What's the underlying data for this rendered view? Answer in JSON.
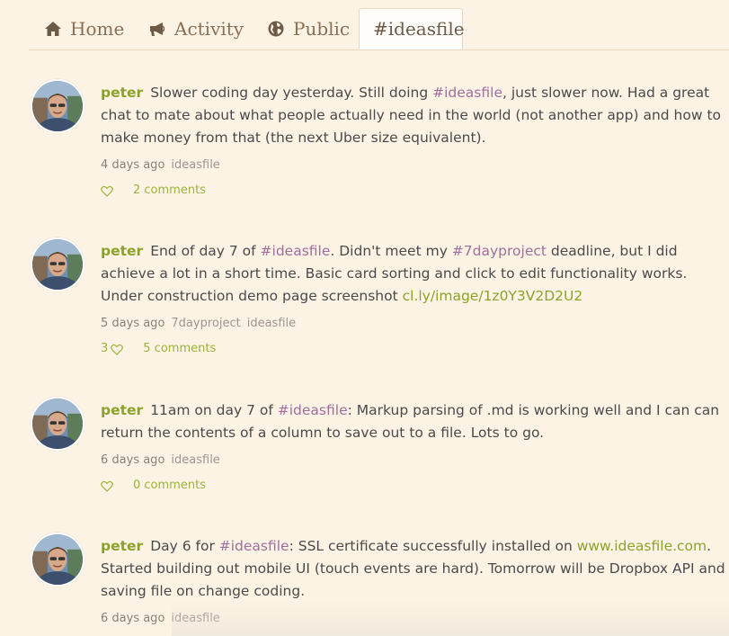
{
  "tabs": [
    {
      "label": "Home",
      "icon": "home-icon"
    },
    {
      "label": "Activity",
      "icon": "megaphone-icon"
    },
    {
      "label": "Public",
      "icon": "globe-icon"
    },
    {
      "label": "#ideasfile",
      "icon": ""
    }
  ],
  "active_tab": "#ideasfile",
  "colors": {
    "author": "#8aa32a",
    "hashtag": "#9e6f9c",
    "link": "#8aa32a",
    "background": "#fdf3e4"
  },
  "posts": [
    {
      "author": "peter",
      "text_parts": [
        {
          "t": "Slower coding day yesterday. Still doing "
        },
        {
          "t": "#ideasfile",
          "kind": "hash"
        },
        {
          "t": ", just slower now. Had a great chat to mate about what people actually need in the world (not another app) and how to make money from that (the next Uber size equivalent)."
        }
      ],
      "time": "4 days ago",
      "tags": [
        "ideasfile"
      ],
      "likes": "",
      "comments": "2 comments"
    },
    {
      "author": "peter",
      "text_parts": [
        {
          "t": "End of day 7 of "
        },
        {
          "t": "#ideasfile",
          "kind": "hash"
        },
        {
          "t": ". Didn't meet my "
        },
        {
          "t": "#7dayproject",
          "kind": "hash"
        },
        {
          "t": " deadline, but I did achieve a lot in a short time. Basic card sorting and click to edit functionality works. Under construction demo page screenshot "
        },
        {
          "t": "cl.ly/image/1z0Y3V2D2U2",
          "kind": "link"
        }
      ],
      "time": "5 days ago",
      "tags": [
        "7dayproject",
        "ideasfile"
      ],
      "likes": "3",
      "comments": "5 comments"
    },
    {
      "author": "peter",
      "text_parts": [
        {
          "t": "11am on day 7 of "
        },
        {
          "t": "#ideasfile",
          "kind": "hash"
        },
        {
          "t": ": Markup parsing of .md is working well and I can can return the contents of a column to save out to a file. Lots to go."
        }
      ],
      "time": "6 days ago",
      "tags": [
        "ideasfile"
      ],
      "likes": "",
      "comments": "0 comments"
    },
    {
      "author": "peter",
      "text_parts": [
        {
          "t": "Day 6 for "
        },
        {
          "t": "#ideasfile",
          "kind": "hash"
        },
        {
          "t": ": SSL certificate successfully installed on "
        },
        {
          "t": "www.ideasfile.com",
          "kind": "link"
        },
        {
          "t": ". Started building out mobile UI (touch events are hard). Tomorrow will be Dropbox API and saving file on change coding."
        }
      ],
      "time": "6 days ago",
      "tags": [
        "ideasfile"
      ],
      "likes": "",
      "comments": ""
    }
  ]
}
